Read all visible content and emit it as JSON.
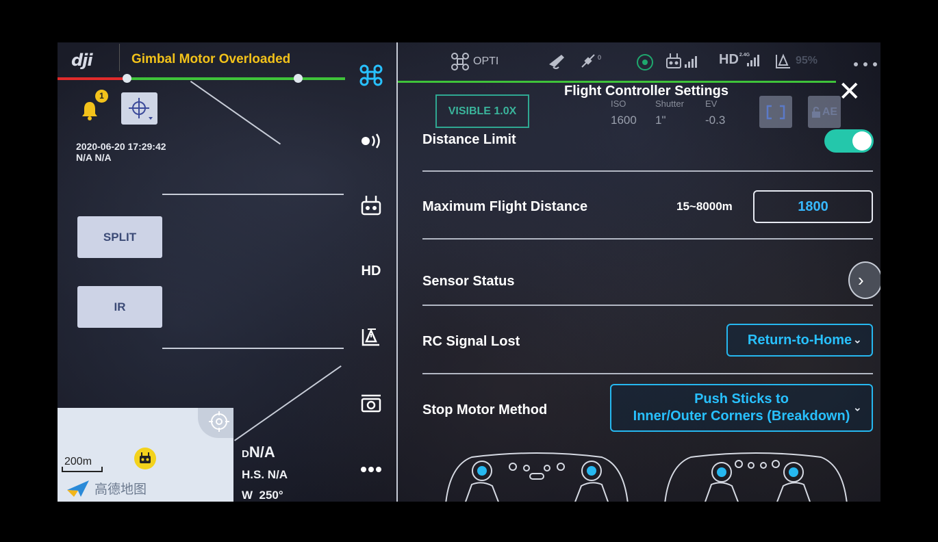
{
  "app": {
    "logo_text": "dji",
    "warning": "Gimbal Motor Overloaded"
  },
  "notifications": {
    "badge_count": "1"
  },
  "info": {
    "datetime": "2020-06-20 17:29:42",
    "location": "N/A N/A"
  },
  "left_buttons": {
    "split_label": "SPLIT",
    "ir_label": "IR"
  },
  "map": {
    "scale_label": "200m",
    "provider_label": "高德地图"
  },
  "telemetry": {
    "d_prefix": "D",
    "d_value": "N/A",
    "hs_label": "H.S.",
    "hs_value": "N/A",
    "w_label": "W",
    "w_value": "250°"
  },
  "toolbar": {
    "hd_label": "HD"
  },
  "status_bar": {
    "mode_label": "OPTI",
    "hd_label": "HD",
    "hd_band": "2.4G",
    "battery_label": "95%",
    "gps_count": "0"
  },
  "camera": {
    "visible_label": "VISIBLE 1.0X",
    "iso_label": "ISO",
    "iso_value": "1600",
    "shutter_label": "Shutter",
    "shutter_value": "1\"",
    "ev_label": "EV",
    "ev_value": "-0.3",
    "ae_label": "AE"
  },
  "panel": {
    "title": "Flight Controller Settings",
    "distance_limit_label": "Distance Limit",
    "distance_limit_enabled": true,
    "max_distance_label": "Maximum Flight Distance",
    "max_distance_range": "15~8000m",
    "max_distance_value": "1800",
    "sensor_status_label": "Sensor Status",
    "rc_signal_lost_label": "RC Signal Lost",
    "rc_signal_lost_value": "Return-to-Home",
    "stop_motor_label": "Stop Motor Method",
    "stop_motor_value_line1": "Push Sticks to",
    "stop_motor_value_line2": "Inner/Outer Corners (Breakdown)"
  },
  "colors": {
    "accent_blue": "#28c1ff",
    "toggle_green": "#24c7ab",
    "warning_yellow": "#f2c21a",
    "link_green": "#3fc33a"
  }
}
